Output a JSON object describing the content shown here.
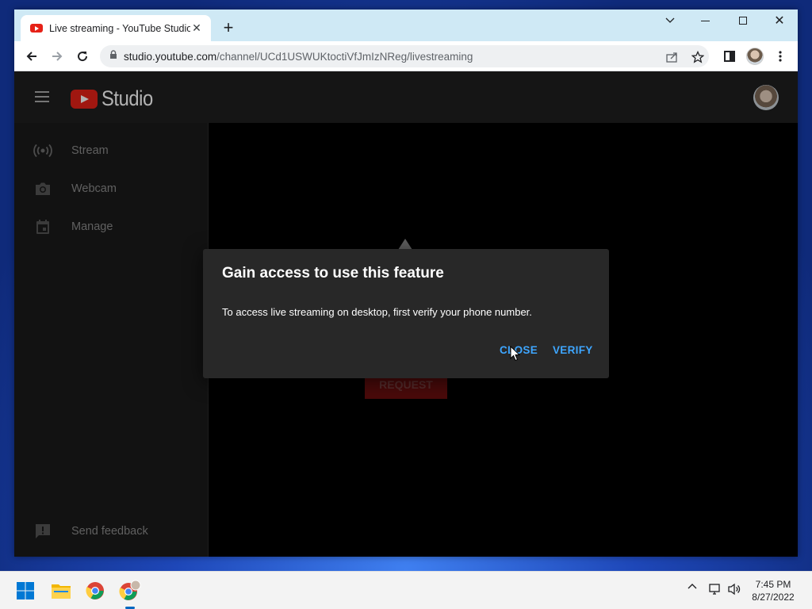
{
  "browser": {
    "tab_title": "Live streaming - YouTube Studio",
    "url_host": "studio.youtube.com",
    "url_path": "/channel/UCd1USWUKtoctiVfJmIzNReg/livestreaming"
  },
  "studio": {
    "logo_text": "Studio",
    "sidebar": {
      "items": [
        {
          "label": "Stream",
          "icon": "broadcast-icon"
        },
        {
          "label": "Webcam",
          "icon": "camera-icon"
        },
        {
          "label": "Manage",
          "icon": "calendar-icon"
        }
      ],
      "feedback_label": "Send feedback"
    },
    "background_button": "REQUEST"
  },
  "dialog": {
    "title": "Gain access to use this feature",
    "body": "To access live streaming on desktop, first verify your phone number.",
    "close_label": "CLOSE",
    "verify_label": "VERIFY"
  },
  "taskbar": {
    "time": "7:45 PM",
    "date": "8/27/2022"
  },
  "colors": {
    "accent_blue": "#3ea6ff",
    "youtube_red": "#e62117",
    "tabbar_bg": "#cfe9f5"
  }
}
